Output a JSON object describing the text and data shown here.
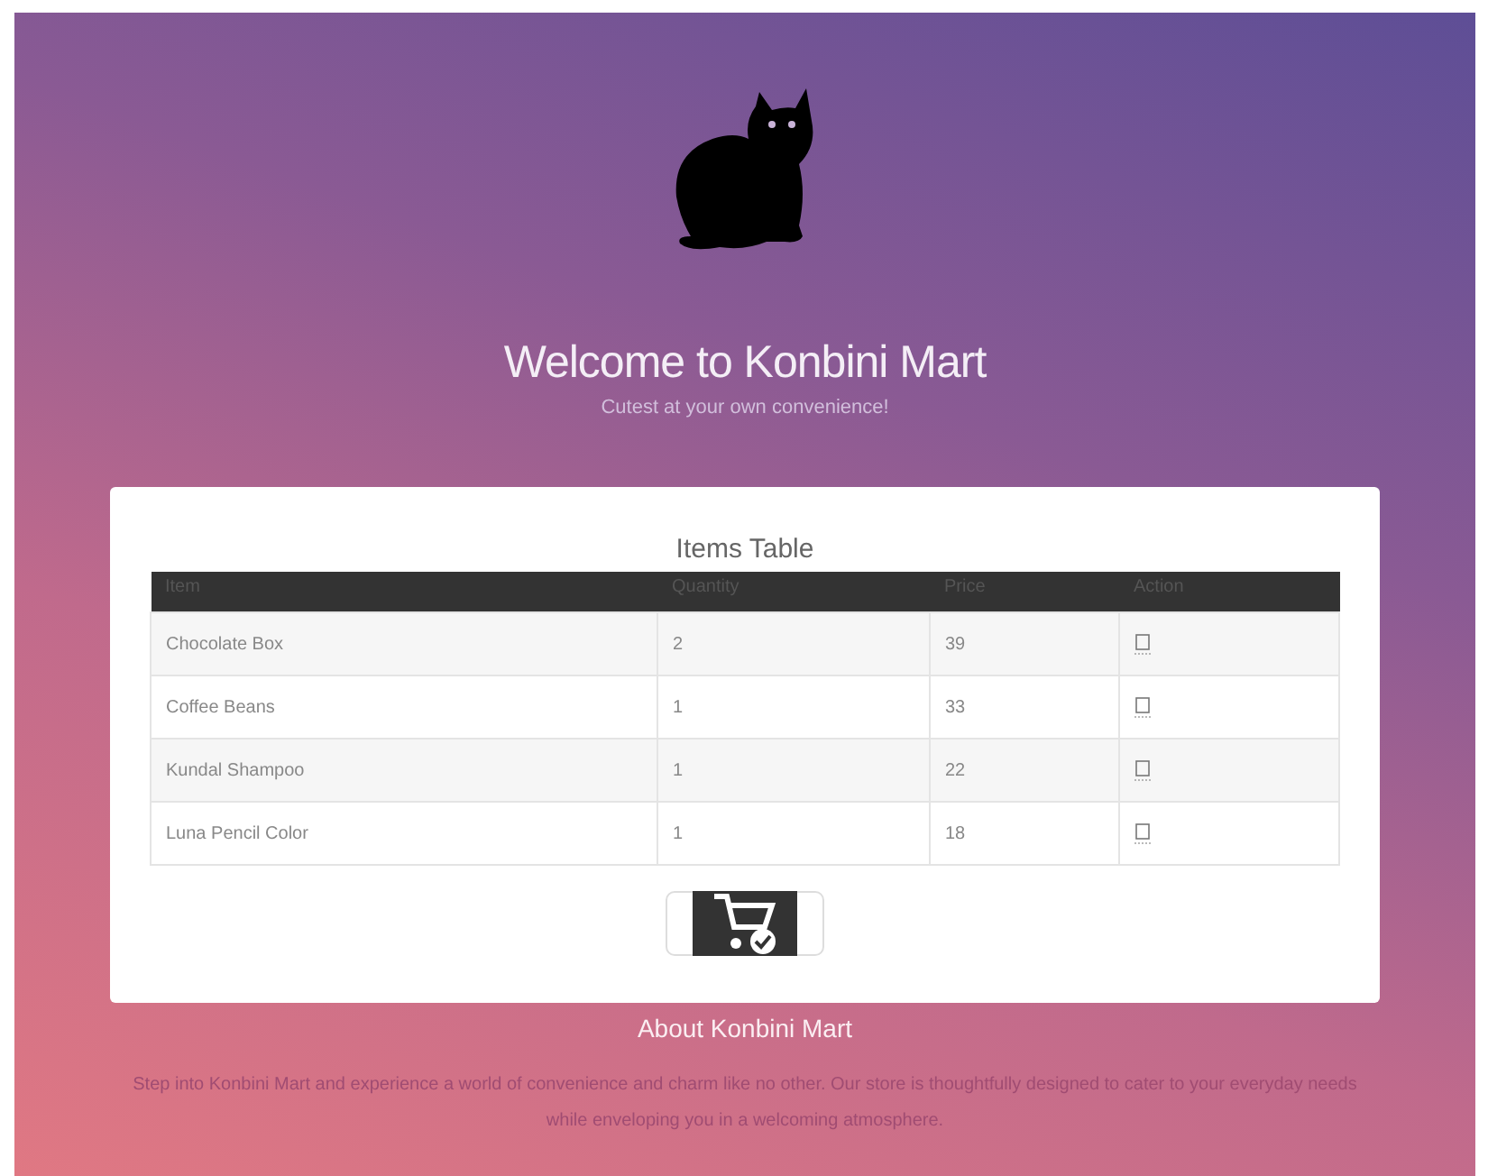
{
  "header": {
    "title": "Welcome to Konbini Mart",
    "tagline": "Cutest at your own convenience!"
  },
  "table": {
    "title": "Items Table",
    "columns": [
      "Item",
      "Quantity",
      "Price",
      "Action"
    ],
    "rows": [
      {
        "item": "Chocolate Box",
        "quantity": "2",
        "price": "39"
      },
      {
        "item": "Coffee Beans",
        "quantity": "1",
        "price": "33"
      },
      {
        "item": "Kundal Shampoo",
        "quantity": "1",
        "price": "22"
      },
      {
        "item": "Luna Pencil Color",
        "quantity": "1",
        "price": "18"
      }
    ]
  },
  "about": {
    "title": "About Konbini Mart",
    "text": "Step into Konbini Mart and experience a world of convenience and charm like no other. Our store is thoughtfully designed to cater to your everyday needs while enveloping you in a welcoming atmosphere."
  }
}
